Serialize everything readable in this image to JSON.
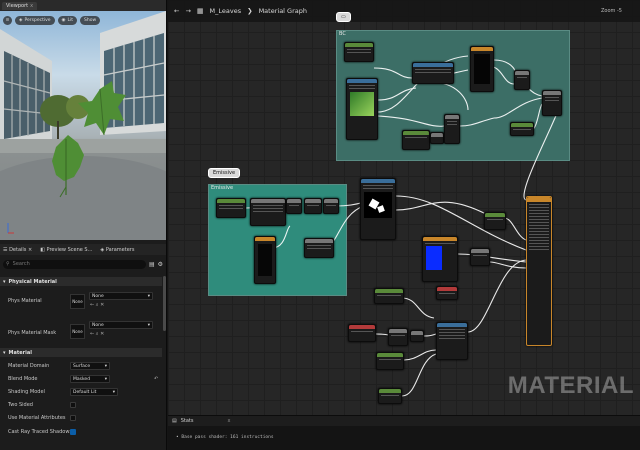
{
  "viewport": {
    "tab_label": "Viewport",
    "tab_close": "x",
    "perspective_label": "Perspective",
    "lit_label": "Lit",
    "show_label": "Show"
  },
  "details": {
    "tab_details": "Details",
    "tab_preview": "Preview Scene S...",
    "tab_parameters": "Parameters",
    "search_placeholder": "Search",
    "physical_section": "Physical Material",
    "phys_material_label": "Phys Material",
    "phys_material_value": "None",
    "phys_mask_label": "Phys Material Mask",
    "phys_mask_value": "None",
    "thumb_none": "None",
    "material_section": "Material",
    "rows": [
      {
        "label": "Material Domain",
        "value": "Surface"
      },
      {
        "label": "Blend Mode",
        "value": "Masked"
      },
      {
        "label": "Shading Model",
        "value": "Default Lit"
      }
    ],
    "two_sided_label": "Two Sided",
    "use_attrs_label": "Use Material Attributes",
    "cast_rt_label": "Cast Ray Traced Shadows"
  },
  "graph": {
    "breadcrumb_asset": "M_Leaves",
    "breadcrumb_sep": "❯",
    "breadcrumb_graph": "Material Graph",
    "zoom_label": "Zoom -5",
    "comment_bc_title": "BC",
    "comment_emissive_title": "Emissive",
    "emissive_bubble": "Emissive",
    "watermark": "MATERIAL",
    "result_node_title": "M_Leaves"
  },
  "stats": {
    "tab_label": "Stats",
    "tab_close": "x",
    "line": "• Base pass shader: 161 instructions"
  },
  "colors": {
    "comment_fill": "#3c6e66",
    "accent_orange": "#c8862a",
    "preview_blue": "#0a2cff",
    "checkbox_blue": "#0b5ea8"
  }
}
